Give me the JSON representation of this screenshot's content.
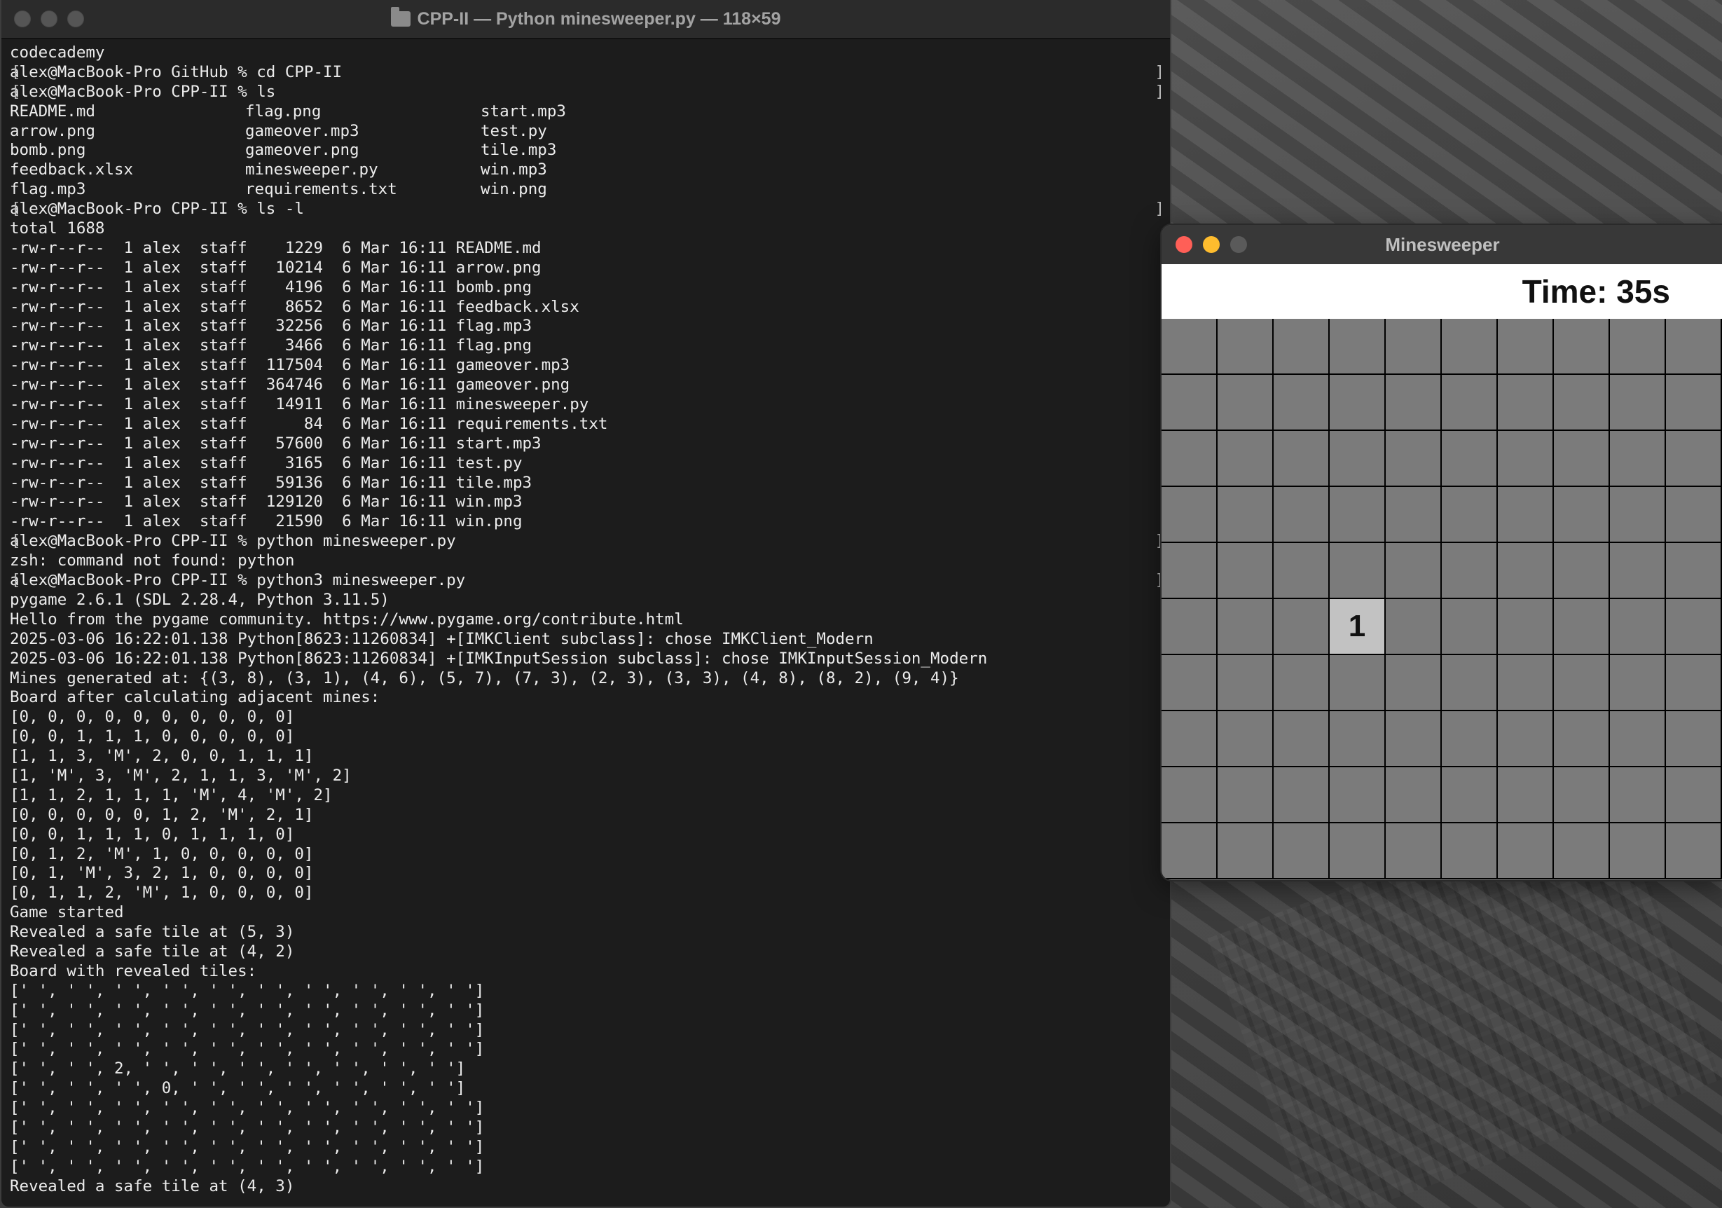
{
  "terminal": {
    "title": "CPP-II — Python minesweeper.py — 118×59",
    "lines": [
      "codecademy",
      "alex@MacBook-Pro GitHub % cd CPP-II",
      "alex@MacBook-Pro CPP-II % ls",
      "README.md               flag.png                start.mp3",
      "arrow.png               gameover.mp3            test.py",
      "bomb.png                gameover.png            tile.mp3",
      "feedback.xlsx           minesweeper.py          win.mp3",
      "flag.mp3                requirements.txt        win.png",
      "alex@MacBook-Pro CPP-II % ls -l",
      "total 1688",
      "-rw-r--r--  1 alex  staff    1229  6 Mar 16:11 README.md",
      "-rw-r--r--  1 alex  staff   10214  6 Mar 16:11 arrow.png",
      "-rw-r--r--  1 alex  staff    4196  6 Mar 16:11 bomb.png",
      "-rw-r--r--  1 alex  staff    8652  6 Mar 16:11 feedback.xlsx",
      "-rw-r--r--  1 alex  staff   32256  6 Mar 16:11 flag.mp3",
      "-rw-r--r--  1 alex  staff    3466  6 Mar 16:11 flag.png",
      "-rw-r--r--  1 alex  staff  117504  6 Mar 16:11 gameover.mp3",
      "-rw-r--r--  1 alex  staff  364746  6 Mar 16:11 gameover.png",
      "-rw-r--r--  1 alex  staff   14911  6 Mar 16:11 minesweeper.py",
      "-rw-r--r--  1 alex  staff      84  6 Mar 16:11 requirements.txt",
      "-rw-r--r--  1 alex  staff   57600  6 Mar 16:11 start.mp3",
      "-rw-r--r--  1 alex  staff    3165  6 Mar 16:11 test.py",
      "-rw-r--r--  1 alex  staff   59136  6 Mar 16:11 tile.mp3",
      "-rw-r--r--  1 alex  staff  129120  6 Mar 16:11 win.mp3",
      "-rw-r--r--  1 alex  staff   21590  6 Mar 16:11 win.png",
      "alex@MacBook-Pro CPP-II % python minesweeper.py",
      "zsh: command not found: python",
      "alex@MacBook-Pro CPP-II % python3 minesweeper.py",
      "pygame 2.6.1 (SDL 2.28.4, Python 3.11.5)",
      "Hello from the pygame community. https://www.pygame.org/contribute.html",
      "2025-03-06 16:22:01.138 Python[8623:11260834] +[IMKClient subclass]: chose IMKClient_Modern",
      "2025-03-06 16:22:01.138 Python[8623:11260834] +[IMKInputSession subclass]: chose IMKInputSession_Modern",
      "Mines generated at: {(3, 8), (3, 1), (4, 6), (5, 7), (7, 3), (2, 3), (3, 3), (4, 8), (8, 2), (9, 4)}",
      "Board after calculating adjacent mines:",
      "[0, 0, 0, 0, 0, 0, 0, 0, 0, 0]",
      "[0, 0, 1, 1, 1, 0, 0, 0, 0, 0]",
      "[1, 1, 3, 'M', 2, 0, 0, 1, 1, 1]",
      "[1, 'M', 3, 'M', 2, 1, 1, 3, 'M', 2]",
      "[1, 1, 2, 1, 1, 1, 'M', 4, 'M', 2]",
      "[0, 0, 0, 0, 0, 1, 2, 'M', 2, 1]",
      "[0, 0, 1, 1, 1, 0, 1, 1, 1, 0]",
      "[0, 1, 2, 'M', 1, 0, 0, 0, 0, 0]",
      "[0, 1, 'M', 3, 2, 1, 0, 0, 0, 0]",
      "[0, 1, 1, 2, 'M', 1, 0, 0, 0, 0]",
      "Game started",
      "Revealed a safe tile at (5, 3)",
      "Revealed a safe tile at (4, 2)",
      "Board with revealed tiles:",
      "[' ', ' ', ' ', ' ', ' ', ' ', ' ', ' ', ' ', ' ']",
      "[' ', ' ', ' ', ' ', ' ', ' ', ' ', ' ', ' ', ' ']",
      "[' ', ' ', ' ', ' ', ' ', ' ', ' ', ' ', ' ', ' ']",
      "[' ', ' ', ' ', ' ', ' ', ' ', ' ', ' ', ' ', ' ']",
      "[' ', ' ', 2, ' ', ' ', ' ', ' ', ' ', ' ', ' ']",
      "[' ', ' ', ' ', 0, ' ', ' ', ' ', ' ', ' ', ' ']",
      "[' ', ' ', ' ', ' ', ' ', ' ', ' ', ' ', ' ', ' ']",
      "[' ', ' ', ' ', ' ', ' ', ' ', ' ', ' ', ' ', ' ']",
      "[' ', ' ', ' ', ' ', ' ', ' ', ' ', ' ', ' ', ' ']",
      "[' ', ' ', ' ', ' ', ' ', ' ', ' ', ' ', ' ', ' ']",
      "Revealed a safe tile at (4, 3)"
    ],
    "prompt_line_indices": [
      1,
      2,
      8,
      25,
      27
    ],
    "ls_row_indices": [
      3,
      4,
      5,
      6,
      7
    ]
  },
  "minesweeper": {
    "title": "Minesweeper",
    "timer": "Time: 35s",
    "rows": 10,
    "cols": 10,
    "revealed_tiles": [
      {
        "row": 5,
        "col": 3,
        "value": "1"
      }
    ]
  },
  "colors": {
    "terminal_bg": "#1c1c1c",
    "terminal_text": "#ececec",
    "tile_hidden": "#7b7b7b",
    "tile_revealed": "#c2c2c2",
    "close": "#ff5f57",
    "minimize": "#febc2e",
    "zoom_inactive": "#5a5a5a"
  }
}
